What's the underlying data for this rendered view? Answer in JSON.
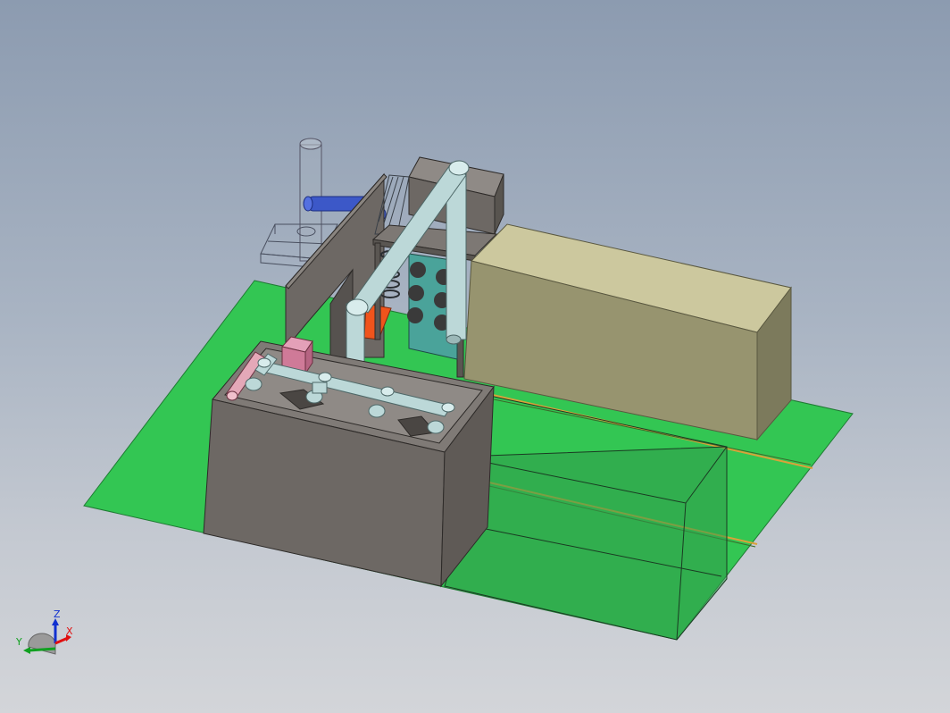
{
  "viewport": {
    "background_top": "#8c9bb0",
    "background_bottom": "#d3d5d9"
  },
  "scene": {
    "floor_color": "#33c653",
    "tank_color": "#6d6864",
    "cabinet_color": "#ccc89e",
    "panel_color": "#4aa39a",
    "pipe_color": "#bcd8d8",
    "blue_pipe_color": "#3c58c8",
    "orange_color": "#f0541c",
    "pink_box_color": "#cf7a98"
  },
  "triad": {
    "x_label": "X",
    "y_label": "Y",
    "z_label": "Z",
    "x_color": "#e01010",
    "y_color": "#10a020",
    "z_color": "#1030d0"
  }
}
